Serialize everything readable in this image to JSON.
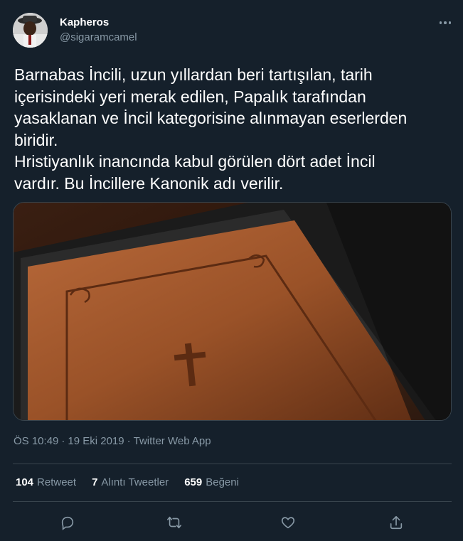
{
  "user": {
    "name": "Kapheros",
    "handle": "@sigaramcamel"
  },
  "tweet": {
    "text": "Barnabas İncili, uzun yıllardan beri tartışılan, tarih\niçerisindeki yeri merak edilen, Papalık tarafından\nyasaklanan ve İncil kategorisine alınmayan eserlerden\nbiridir.\nHristiyanlık inancında kabul görülen dört adet İncil\nvardır. Bu İncillere Kanonik adı verilir.",
    "time": "ÖS 10:49",
    "sep1": "·",
    "date": "19 Eki 2019",
    "sep2": "·",
    "source": "Twitter Web App"
  },
  "stats": {
    "retweets_count": "104",
    "retweets_label": "Retweet",
    "quotes_count": "7",
    "quotes_label": "Alıntı Tweetler",
    "likes_count": "659",
    "likes_label": "Beğeni"
  },
  "colors": {
    "background": "#15202b",
    "secondary_text": "#8899a6",
    "divider": "#38444d"
  },
  "icons": {
    "more": "more-icon",
    "reply": "reply-icon",
    "retweet": "retweet-icon",
    "like": "like-icon",
    "share": "share-icon"
  }
}
